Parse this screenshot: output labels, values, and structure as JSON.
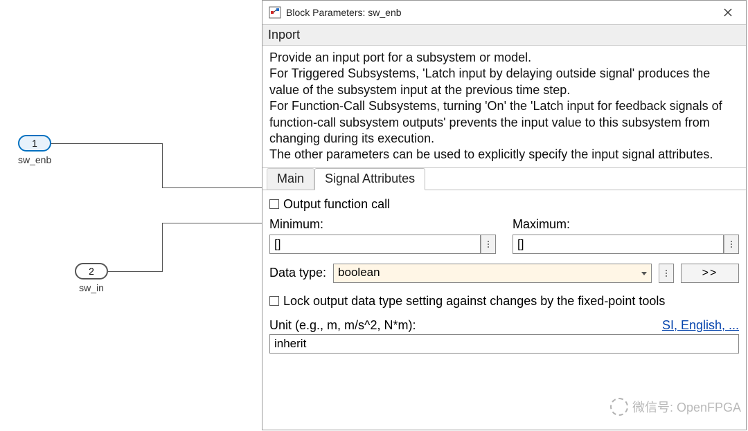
{
  "canvas": {
    "ports": {
      "p1": {
        "index": "1",
        "label": "sw_enb"
      },
      "p2": {
        "index": "2",
        "label": "sw_in"
      }
    }
  },
  "dialog": {
    "title": "Block Parameters: sw_enb",
    "section_title": "Inport",
    "description": "Provide an input port for a subsystem or model.\nFor Triggered Subsystems, 'Latch input by delaying outside signal' produces the value of the subsystem input at the previous time step.\nFor Function-Call Subsystems, turning 'On' the 'Latch input for feedback signals of function-call subsystem outputs' prevents the input value to this subsystem from changing during its execution.\nThe other parameters can be used to explicitly specify the input signal attributes.",
    "tabs": {
      "main": "Main",
      "signal_attributes": "Signal Attributes"
    },
    "form": {
      "output_fcn_call_label": "Output function call",
      "output_fcn_call_checked": false,
      "min_label": "Minimum:",
      "min_value": "[]",
      "max_label": "Maximum:",
      "max_value": "[]",
      "data_type_label": "Data type:",
      "data_type_value": "boolean",
      "more_button": ">>",
      "lock_label": "Lock output data type setting against changes by the fixed-point tools",
      "lock_checked": false,
      "unit_label": "Unit (e.g., m, m/s^2, N*m):",
      "unit_help_link": "SI, English, ...",
      "unit_value": "inherit"
    }
  },
  "watermark": "微信号: OpenFPGA"
}
